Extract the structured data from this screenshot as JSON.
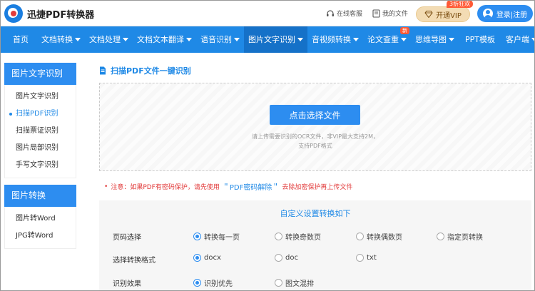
{
  "header": {
    "logo_text": "迅捷PDF转换器",
    "service_label": "在线客服",
    "my_files_label": "我的文件",
    "vip_label": "开通VIP",
    "vip_badge": "3折狂欢",
    "login_label": "登录|注册"
  },
  "nav": {
    "items": [
      {
        "label": "首页"
      },
      {
        "label": "文档转换"
      },
      {
        "label": "文档处理"
      },
      {
        "label": "文档文本翻译"
      },
      {
        "label": "语音识别"
      },
      {
        "label": "图片文字识别"
      },
      {
        "label": "音视频转换"
      },
      {
        "label": "论文查重"
      },
      {
        "label": "思维导图"
      },
      {
        "label": "PPT模板"
      },
      {
        "label": "客户端"
      }
    ],
    "new_badge": "新"
  },
  "sidebar": {
    "group1_title": "图片文字识别",
    "group1_items": [
      "图片文字识别",
      "扫描PDF识别",
      "扫描票证识别",
      "图片局部识别",
      "手写文字识别"
    ],
    "group2_title": "图片转换",
    "group2_items": [
      "图片转Word",
      "JPG转Word"
    ]
  },
  "main": {
    "title": "扫描PDF文件一键识别",
    "upload_button": "点击选择文件",
    "upload_hint_line1": "请上传需要识别的OCR文件，非VIP最大支持2M，",
    "upload_hint_line2": "支持PDF格式",
    "notice_prefix": "注意：如果PDF有密码保护，请先使用",
    "notice_link": "＂PDF密码解除＂",
    "notice_suffix": "去除加密保护再上传文件"
  },
  "settings": {
    "title": "自定义设置转换如下",
    "rows": [
      {
        "label": "页码选择",
        "options": [
          "转换每一页",
          "转换奇数页",
          "转换偶数页",
          "指定页转换"
        ],
        "selected": 0
      },
      {
        "label": "选择转换格式",
        "options": [
          "docx",
          "doc",
          "txt"
        ],
        "selected": 0
      },
      {
        "label": "识别效果",
        "options": [
          "识别优先",
          "图文混排"
        ],
        "selected": 0
      }
    ]
  },
  "colors": {
    "primary": "#1f89e6",
    "nav_active": "#1571c8",
    "warning": "#e23b3b"
  }
}
